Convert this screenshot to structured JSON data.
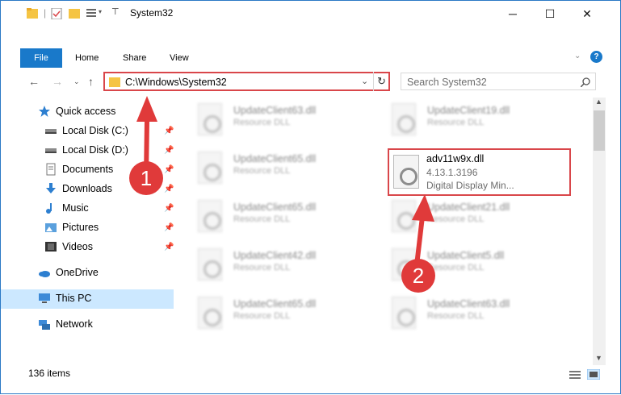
{
  "window": {
    "title": "System32"
  },
  "ribbon": {
    "tabs": [
      "File",
      "Home",
      "Share",
      "View"
    ]
  },
  "address": {
    "path": "C:\\Windows\\System32"
  },
  "search": {
    "placeholder": "Search System32"
  },
  "sidebar": {
    "items": [
      {
        "label": "Quick access",
        "icon": "star-icon",
        "pinned": false
      },
      {
        "label": "Local Disk (C:)",
        "icon": "drive-icon",
        "pinned": true
      },
      {
        "label": "Local Disk (D:)",
        "icon": "drive-icon",
        "pinned": true
      },
      {
        "label": "Documents",
        "icon": "documents-icon",
        "pinned": true
      },
      {
        "label": "Downloads",
        "icon": "downloads-icon",
        "pinned": true
      },
      {
        "label": "Music",
        "icon": "music-icon",
        "pinned": true
      },
      {
        "label": "Pictures",
        "icon": "pictures-icon",
        "pinned": true
      },
      {
        "label": "Videos",
        "icon": "videos-icon",
        "pinned": true
      },
      {
        "label": "OneDrive",
        "icon": "onedrive-icon",
        "pinned": false
      },
      {
        "label": "This PC",
        "icon": "this-pc-icon",
        "pinned": false,
        "selected": true
      },
      {
        "label": "Network",
        "icon": "network-icon",
        "pinned": false
      }
    ]
  },
  "files": [
    {
      "name": "UpdateClient63.dll",
      "type": "Resource DLL"
    },
    {
      "name": "UpdateClient19.dll",
      "type": "Resource DLL"
    },
    {
      "name": "UpdateClient65.dll",
      "type": "Resource DLL"
    },
    {
      "name": "UpdateClient65.dll",
      "type": "Resource DLL"
    },
    {
      "name": "UpdateClient21.dll",
      "type": "Resource DLL"
    },
    {
      "name": "UpdateClient42.dll",
      "type": "Resource DLL"
    },
    {
      "name": "UpdateClient5.dll",
      "type": "Resource DLL"
    },
    {
      "name": "UpdateClient65.dll",
      "type": "Resource DLL"
    },
    {
      "name": "UpdateClient63.dll",
      "type": "Resource DLL"
    }
  ],
  "highlighted_file": {
    "name": "adv11w9x.dll",
    "version": "4.13.1.3196",
    "description": "Digital Display Min..."
  },
  "status": {
    "item_count": "136 items"
  },
  "annotations": {
    "step1": "1",
    "step2": "2"
  },
  "colors": {
    "accent": "#1979ca",
    "highlight": "#d9464a",
    "selection": "#cce8ff"
  }
}
